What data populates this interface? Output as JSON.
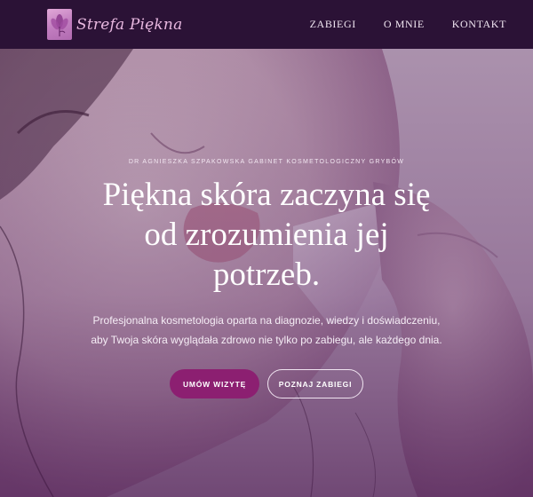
{
  "brand": {
    "name": "Strefa Piękna",
    "logo_icon": "flower-logo-icon"
  },
  "nav": {
    "links": [
      "ZABIEGI",
      "O MNIE",
      "KONTAKT"
    ]
  },
  "hero": {
    "eyebrow": "DR AGNIESZKA SZPAKOWSKA GABINET KOSMETOLOGICZNY GRYBÓW",
    "headline": "Piękna skóra zaczyna się od zrozumienia jej potrzeb.",
    "subtext": "Profesjonalna kosmetologia oparta na diagnozie, wiedzy i doświadczeniu, aby Twoja skóra wyglądała zdrowo nie tylko po zabiegu, ale każdego dnia.",
    "primary_button": "UMÓW WIZYTĘ",
    "secondary_button": "POZNAJ ZABIEGI"
  },
  "colors": {
    "navbar": "#2b1236",
    "accent": "#8c1f71",
    "logo_text": "#e8b8e0"
  }
}
